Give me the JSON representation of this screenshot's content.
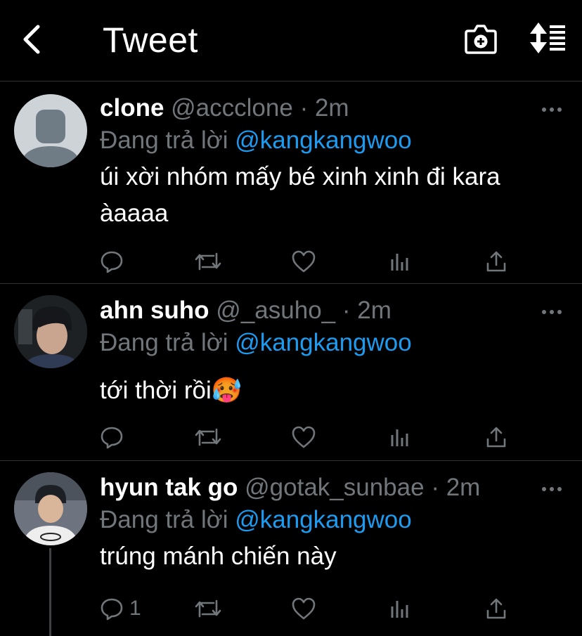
{
  "header": {
    "title": "Tweet",
    "back_icon": "chevron-left-icon",
    "camera_icon": "camera-plus-icon",
    "sort_icon": "sort-icon"
  },
  "colors": {
    "background": "#000000",
    "text_primary": "#ffffff",
    "text_secondary": "#71767b",
    "accent": "#1d9bf0",
    "divider": "#2f3336"
  },
  "tweets": [
    {
      "name": "clone",
      "handle": "@accclone",
      "separator": "·",
      "time": "2m",
      "reply_prefix": "Đang trả lời",
      "reply_to": "@kangkangwoo",
      "text": "úi xời nhóm mấy bé xinh xinh đi kara àaaaa",
      "reply_count": ""
    },
    {
      "name": "ahn suho",
      "handle": "@_asuho_",
      "separator": "·",
      "time": "2m",
      "reply_prefix": "Đang trả lời",
      "reply_to": "@kangkangwoo",
      "text": "tới thời rồi🥵",
      "reply_count": ""
    },
    {
      "name": "hyun tak go",
      "handle": "@gotak_sunbae",
      "separator": "·",
      "time": "2m",
      "reply_prefix": "Đang trả lời",
      "reply_to": "@kangkangwoo",
      "text": "trúng mánh chiến này",
      "reply_count": "1"
    }
  ]
}
